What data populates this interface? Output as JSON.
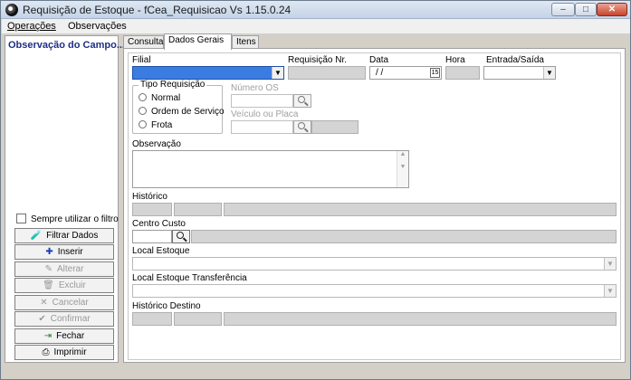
{
  "window": {
    "title": "Requisição de Estoque - fCea_Requisicao Vs 1.15.0.24",
    "controls": {
      "minimize": "–",
      "maximize": "□",
      "close": "✕"
    }
  },
  "menu": [
    {
      "label": "Operações",
      "mnemonic": "O"
    },
    {
      "label": "Observações",
      "mnemonic": "b"
    }
  ],
  "left_panel": {
    "observation_title": "Observação do Campo...",
    "checkbox_label": "Sempre utilizar o filtro",
    "buttons": [
      {
        "label": "Filtrar Dados",
        "icon": "flask-icon",
        "glyph": "🧪",
        "enabled": true
      },
      {
        "label": "Inserir",
        "icon": "insert-icon",
        "glyph": "✚",
        "enabled": true
      },
      {
        "label": "Alterar",
        "icon": "edit-icon",
        "glyph": "✎",
        "enabled": false
      },
      {
        "label": "Excluir",
        "icon": "trash-icon",
        "glyph": "🗑",
        "enabled": false
      },
      {
        "label": "Cancelar",
        "icon": "cancel-icon",
        "glyph": "✕",
        "enabled": false
      },
      {
        "label": "Confirmar",
        "icon": "check-icon",
        "glyph": "✔",
        "enabled": false
      },
      {
        "label": "Fechar",
        "icon": "close-door-icon",
        "glyph": "⇥",
        "enabled": true
      },
      {
        "label": "Imprimir",
        "icon": "printer-icon",
        "glyph": "⎙",
        "enabled": true
      }
    ]
  },
  "tabs": [
    {
      "label": "Consulta",
      "active": false
    },
    {
      "label": "Dados Gerais",
      "active": true
    },
    {
      "label": "Itens",
      "active": false
    }
  ],
  "form": {
    "filial_label": "Filial",
    "requisicao_label": "Requisição Nr.",
    "data_label": "Data",
    "data_value": " /  /",
    "hora_label": "Hora",
    "entrada_saida_label": "Entrada/Saída",
    "tipo_requisicao": {
      "title": "Tipo Requisição",
      "options": [
        "Normal",
        "Ordem de Serviço",
        "Frota"
      ]
    },
    "numero_os_label": "Número OS",
    "veiculo_label": "Veículo ou Placa",
    "observacao_label": "Observação",
    "historico_label": "Histórico",
    "centro_custo_label": "Centro Custo",
    "local_estoque_label": "Local Estoque",
    "local_estoque_transf_label": "Local Estoque Transferência",
    "historico_destino_label": "Histórico Destino"
  },
  "colors": {
    "selected_field": "#3b7ce0",
    "readonly_field": "#d4d4d4",
    "panel_title": "#1e2f86"
  }
}
